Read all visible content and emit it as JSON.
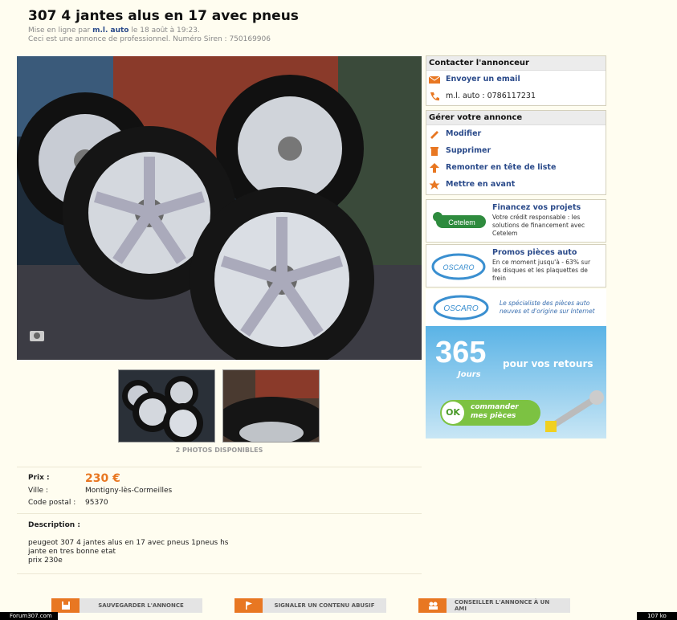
{
  "listing": {
    "title": "307 4 jantes alus en 17 avec pneus",
    "posted_prefix": "Mise en ligne par",
    "seller": "m.l. auto",
    "posted_date": "le 18 août à 19:23.",
    "pro_notice": "Ceci est une annonce de professionnel. Numéro Siren : 750169906",
    "photos_count_label": "2 PHOTOS DISPONIBLES",
    "price_label": "Prix :",
    "price": "230 €",
    "city_label": "Ville :",
    "city": "Montigny-lès-Cormeilles",
    "postcode_label": "Code postal :",
    "postcode": "95370",
    "description_label": "Description :",
    "description_lines": [
      "peugeot 307 4 jantes alus en 17 avec pneus 1pneus hs",
      "jante en tres bonne etat",
      "prix 230e"
    ]
  },
  "contact_box": {
    "header": "Contacter l'annonceur",
    "email_label": "Envoyer un email",
    "phone_label": "m.l. auto : 0786117231"
  },
  "manage_box": {
    "header": "Gérer votre annonce",
    "items": [
      "Modifier",
      "Supprimer",
      "Remonter en tête de liste",
      "Mettre en avant"
    ]
  },
  "promos": [
    {
      "brand": "Cetelem",
      "title": "Financez vos projets",
      "desc": "Votre crédit responsable : les solutions de financement avec Cetelem"
    },
    {
      "brand": "OSCARO",
      "title": "Promos pièces auto",
      "desc": "En ce moment jusqu'à - 63% sur les disques et les plaquettes de frein"
    }
  ],
  "oscaro_banner": {
    "brand": "OSCARO",
    "tagline": "Le spécialiste des pièces auto neuves et d'origine sur Internet",
    "big_number": "365",
    "big_text": "pour vos retours",
    "days_label": "Jours",
    "ok_label": "OK",
    "cta": "commander mes pièces"
  },
  "actions": [
    "SAUVEGARDER L'ANNONCE",
    "SIGNALER UN CONTENU ABUSIF",
    "CONSEILLER L'ANNONCE À UN AMI"
  ],
  "footer": {
    "left": "Forum307.com",
    "right": "107 ko"
  },
  "colors": {
    "accent": "#e87722",
    "link": "#2a4a8a",
    "background": "#fffdf0"
  }
}
